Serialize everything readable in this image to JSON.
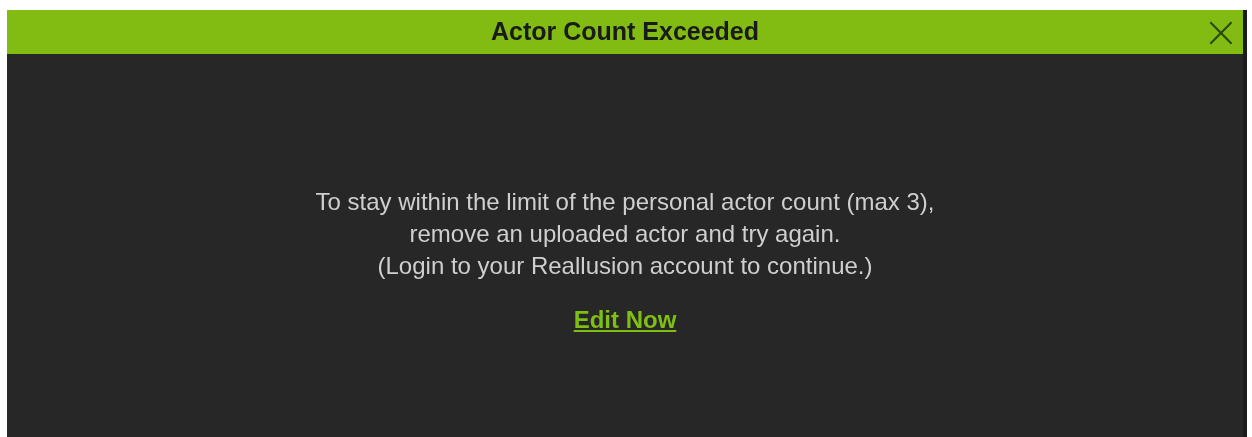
{
  "dialog": {
    "title": "Actor Count Exceeded",
    "close_label": "×",
    "message": [
      "To stay within the limit of the personal actor count (max 3),",
      "remove an uploaded actor and try again.",
      "(Login to your Reallusion account to continue.)"
    ],
    "link": "Edit Now"
  }
}
